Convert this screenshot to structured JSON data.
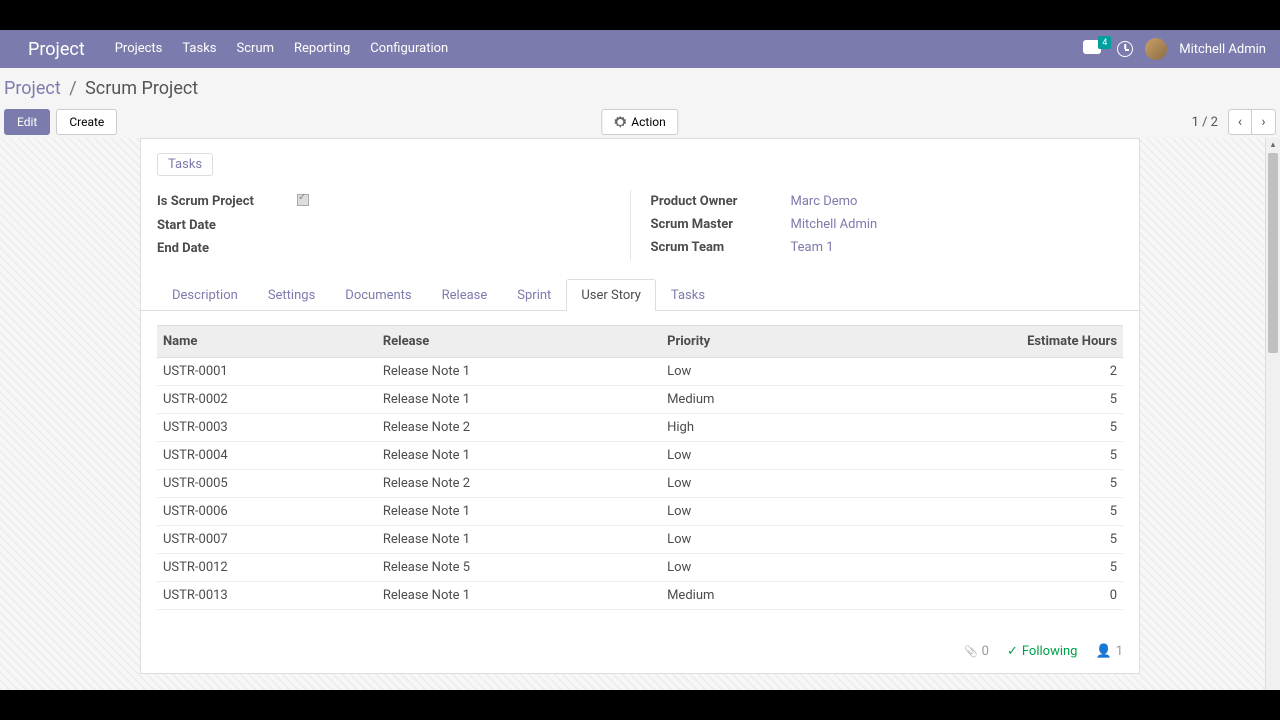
{
  "nav": {
    "brand": "Project",
    "menu": [
      "Projects",
      "Tasks",
      "Scrum",
      "Reporting",
      "Configuration"
    ],
    "chat_badge": "4",
    "user": "Mitchell Admin"
  },
  "breadcrumb": {
    "parent": "Project",
    "current": "Scrum Project"
  },
  "toolbar": {
    "edit": "Edit",
    "create": "Create",
    "action": "Action",
    "pager_text": "1 / 2"
  },
  "sheet": {
    "tasks_button": "Tasks",
    "left_fields": [
      {
        "label": "Is Scrum Project",
        "type": "checkbox"
      },
      {
        "label": "Start Date",
        "value": ""
      },
      {
        "label": "End Date",
        "value": ""
      }
    ],
    "right_fields": [
      {
        "label": "Product Owner",
        "value": "Marc Demo"
      },
      {
        "label": "Scrum Master",
        "value": "Mitchell Admin"
      },
      {
        "label": "Scrum Team",
        "value": "Team 1"
      }
    ],
    "tabs": [
      "Description",
      "Settings",
      "Documents",
      "Release",
      "Sprint",
      "User Story",
      "Tasks"
    ],
    "active_tab": "User Story",
    "table": {
      "headers": [
        "Name",
        "Release",
        "Priority",
        "Estimate Hours"
      ],
      "rows": [
        [
          "USTR-0001",
          "Release Note 1",
          "Low",
          "2"
        ],
        [
          "USTR-0002",
          "Release Note 1",
          "Medium",
          "5"
        ],
        [
          "USTR-0003",
          "Release Note 2",
          "High",
          "5"
        ],
        [
          "USTR-0004",
          "Release Note 1",
          "Low",
          "5"
        ],
        [
          "USTR-0005",
          "Release Note 2",
          "Low",
          "5"
        ],
        [
          "USTR-0006",
          "Release Note 1",
          "Low",
          "5"
        ],
        [
          "USTR-0007",
          "Release Note 1",
          "Low",
          "5"
        ],
        [
          "USTR-0012",
          "Release Note 5",
          "Low",
          "5"
        ],
        [
          "USTR-0013",
          "Release Note 1",
          "Medium",
          "0"
        ]
      ]
    },
    "footer": {
      "attachments": "0",
      "following": "Following",
      "followers": "1"
    }
  }
}
